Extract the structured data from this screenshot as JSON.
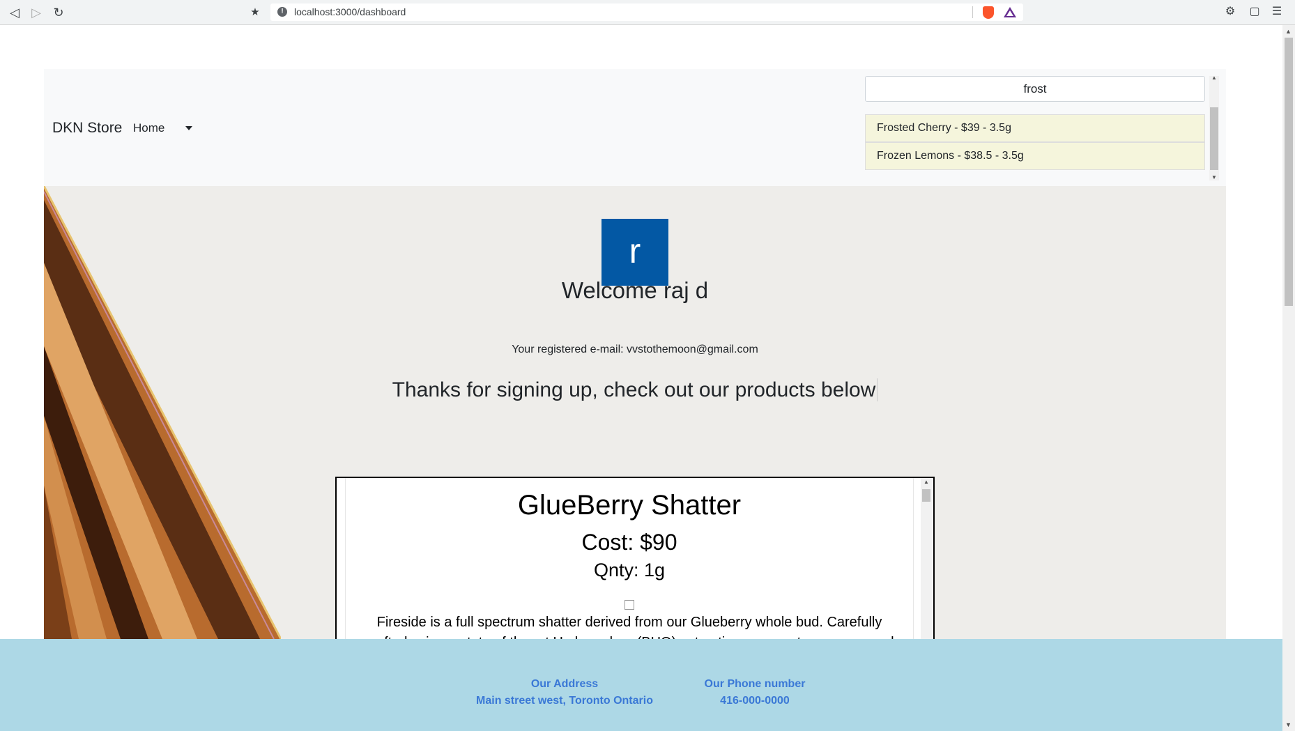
{
  "browser": {
    "url": "localhost:3000/dashboard"
  },
  "navbar": {
    "brand": "DKN Store",
    "home_label": "Home",
    "search_value": "frost",
    "results": [
      "Frosted Cherry - $39 - 3.5g",
      "Frozen Lemons - $38.5 - 3.5g"
    ]
  },
  "profile": {
    "avatar_letter": "r",
    "welcome": "Welcome raj d",
    "email_line": "Your registered e-mail: vvstothemoon@gmail.com",
    "thanks": "Thanks for signing up, check out our products below"
  },
  "product": {
    "name": "GlueBerry Shatter",
    "cost": "Cost: $90",
    "qnty": "Qnty: 1g",
    "description": "Fireside is a full spectrum shatter derived from our Glueberry whole bud. Carefully crafted using a state of the art Hydrocarbon (BHO) extraction process to preserve and"
  },
  "footer": {
    "address_title": "Our Address",
    "address_value": "Main street west, Toronto Ontario",
    "phone_title": "Our Phone number",
    "phone_value": "416-000-0000"
  },
  "colors": {
    "avatar_bg": "#0358a4",
    "footer_bg": "#add8e6",
    "footer_text": "#3a78d6",
    "result_bg": "#f5f5dc"
  }
}
